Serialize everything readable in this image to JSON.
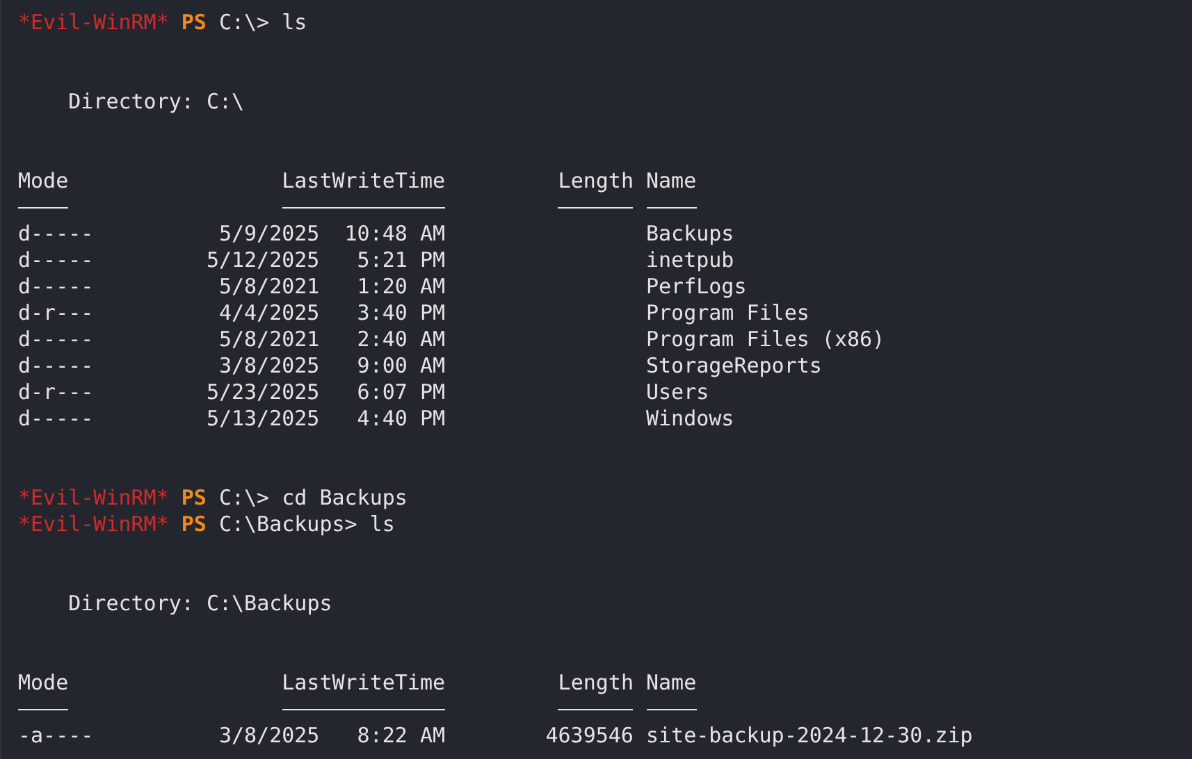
{
  "terminal": {
    "blocks": [
      {
        "kind": "prompt",
        "shell": "*Evil-WinRM*",
        "ps": "PS",
        "path": "C:\\>",
        "command": "ls"
      },
      {
        "kind": "directory",
        "text": "Directory: C:\\"
      },
      {
        "kind": "table",
        "columns": [
          "Mode",
          "LastWriteTime",
          "Length",
          "Name"
        ],
        "rows": [
          {
            "mode": "d-----",
            "date": "5/9/2025",
            "time": "10:48 AM",
            "name": "Backups"
          },
          {
            "mode": "d-----",
            "date": "5/12/2025",
            "time": "5:21 PM",
            "name": "inetpub"
          },
          {
            "mode": "d-----",
            "date": "5/8/2021",
            "time": "1:20 AM",
            "name": "PerfLogs"
          },
          {
            "mode": "d-r---",
            "date": "4/4/2025",
            "time": "3:40 PM",
            "name": "Program Files"
          },
          {
            "mode": "d-----",
            "date": "5/8/2021",
            "time": "2:40 AM",
            "name": "Program Files (x86)"
          },
          {
            "mode": "d-----",
            "date": "3/8/2025",
            "time": "9:00 AM",
            "name": "StorageReports"
          },
          {
            "mode": "d-r---",
            "date": "5/23/2025",
            "time": "6:07 PM",
            "name": "Users"
          },
          {
            "mode": "d-----",
            "date": "5/13/2025",
            "time": "4:40 PM",
            "name": "Windows"
          }
        ]
      },
      {
        "kind": "prompt",
        "shell": "*Evil-WinRM*",
        "ps": "PS",
        "path": "C:\\>",
        "command": "cd Backups"
      },
      {
        "kind": "prompt",
        "shell": "*Evil-WinRM*",
        "ps": "PS",
        "path": "C:\\Backups>",
        "command": "ls"
      },
      {
        "kind": "directory",
        "text": "Directory: C:\\Backups"
      },
      {
        "kind": "table",
        "columns": [
          "Mode",
          "LastWriteTime",
          "Length",
          "Name"
        ],
        "rows": [
          {
            "mode": "-a----",
            "date": "3/8/2025",
            "time": "8:22 AM",
            "length": "4639546",
            "name": "site-backup-2024-12-30.zip"
          }
        ]
      }
    ]
  }
}
